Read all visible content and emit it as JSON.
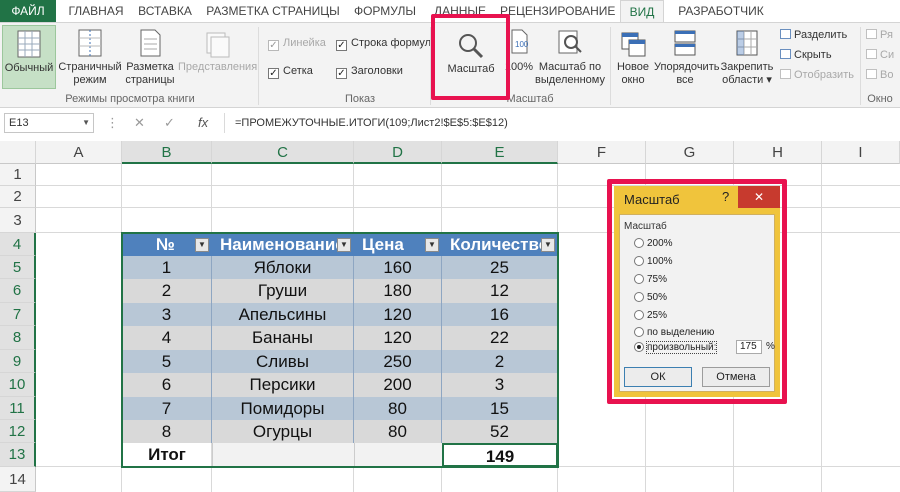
{
  "tabs": [
    "ФАЙЛ",
    "ГЛАВНАЯ",
    "ВСТАВКА",
    "РАЗМЕТКА СТРАНИЦЫ",
    "ФОРМУЛЫ",
    "ДАННЫЕ",
    "РЕЦЕНЗИРОВАНИЕ",
    "ВИД",
    "РАЗРАБОТЧИК"
  ],
  "active_tab": "ВИД",
  "ribbon": {
    "views": {
      "normal": "Обычный",
      "page_break_line1": "Страничный",
      "page_break_line2": "режим",
      "layout_line1": "Разметка",
      "layout_line2": "страницы",
      "custom": "Представления",
      "group": "Режимы просмотра книги"
    },
    "show": {
      "ruler": "Линейка",
      "formula_bar": "Строка формул",
      "gridlines": "Сетка",
      "headings": "Заголовки",
      "group": "Показ"
    },
    "zoom": {
      "zoom": "Масштаб",
      "hundred": "100%",
      "selection_line1": "Масштаб по",
      "selection_line2": "выделенному",
      "group": "Масштаб"
    },
    "window": {
      "new_line1": "Новое",
      "new_line2": "окно",
      "arrange_line1": "Упорядочить",
      "arrange_line2": "все",
      "freeze_line1": "Закрепить",
      "freeze_line2": "области ▾",
      "split": "Разделить",
      "hide": "Скрыть",
      "unhide": "Отобразить",
      "group": "Окно",
      "extra1": "Ря",
      "extra2": "Си",
      "extra3": "Во"
    }
  },
  "formula_bar": {
    "name_box": "E13",
    "formula": "=ПРОМЕЖУТОЧНЫЕ.ИТОГИ(109;Лист2!$E$5:$E$12)"
  },
  "columns": [
    "A",
    "B",
    "C",
    "D",
    "E",
    "F",
    "G",
    "H",
    "I"
  ],
  "rows": [
    "1",
    "2",
    "3",
    "4",
    "5",
    "6",
    "7",
    "8",
    "9",
    "10",
    "11",
    "12",
    "13",
    "14"
  ],
  "table": {
    "headers": [
      "№",
      "Наименование",
      "Цена",
      "Количество"
    ],
    "rows": [
      [
        "1",
        "Яблоки",
        "160",
        "25"
      ],
      [
        "2",
        "Груши",
        "180",
        "12"
      ],
      [
        "3",
        "Апельсины",
        "120",
        "16"
      ],
      [
        "4",
        "Бананы",
        "120",
        "22"
      ],
      [
        "5",
        "Сливы",
        "250",
        "2"
      ],
      [
        "6",
        "Персики",
        "200",
        "3"
      ],
      [
        "7",
        "Помидоры",
        "80",
        "15"
      ],
      [
        "8",
        "Огурцы",
        "80",
        "52"
      ]
    ],
    "total_label": "Итог",
    "total_value": "149"
  },
  "dialog": {
    "title": "Масштаб",
    "help": "?",
    "close": "✕",
    "group": "Масштаб",
    "options": [
      "200%",
      "100%",
      "75%",
      "50%",
      "25%",
      "по выделению",
      "произвольный:"
    ],
    "selected": "произвольный:",
    "custom_value": "175",
    "percent": "%",
    "ok": "ОК",
    "cancel": "Отмена"
  },
  "colors": {
    "excel_green": "#217346",
    "highlight": "#e8124f",
    "table_header": "#4f81bd",
    "row_band_dark": "#b8c7d6",
    "row_band_light": "#d9d9d9",
    "dialog_title": "#f0c43c"
  }
}
